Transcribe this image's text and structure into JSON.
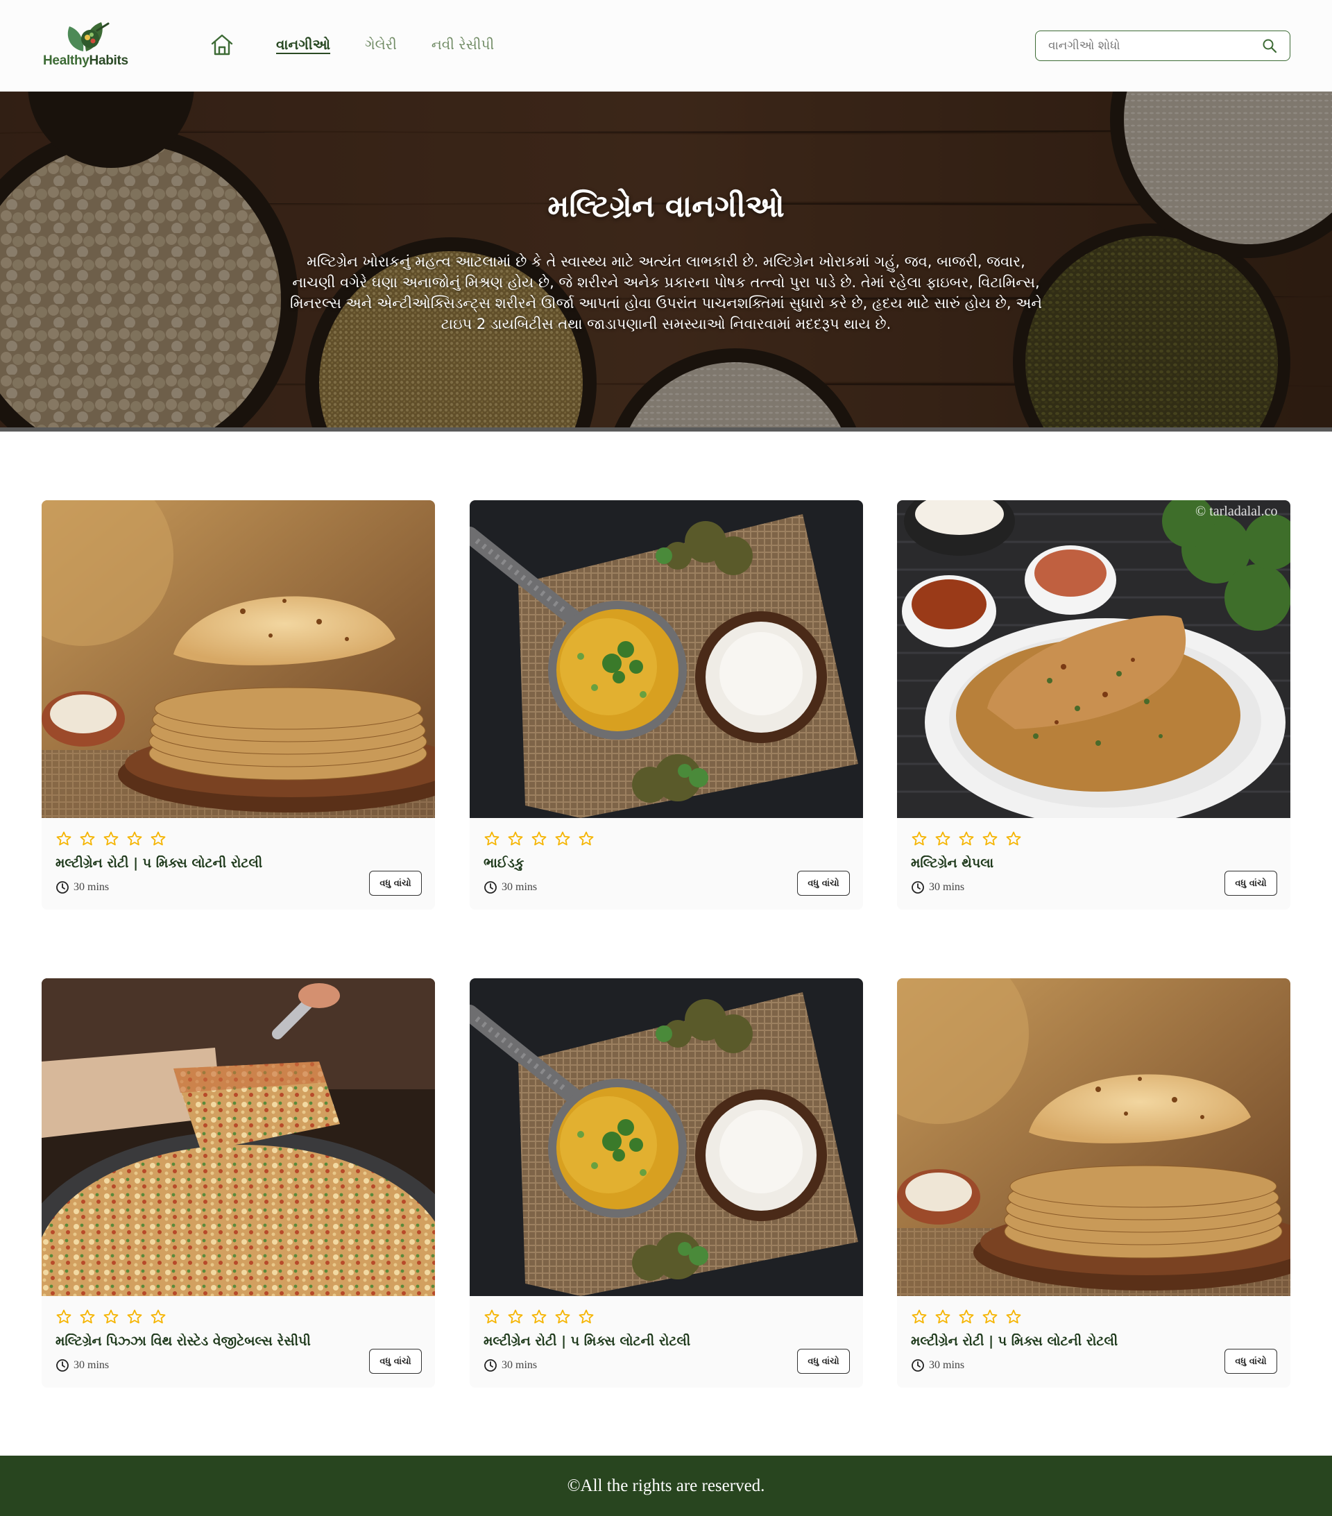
{
  "brand": {
    "name_part1": "Healthy",
    "name_part2": "Habits"
  },
  "nav": {
    "home_icon": "home-icon",
    "links": [
      {
        "label": "વાનગીઓ",
        "active": true
      },
      {
        "label": "ગેલેરી",
        "active": false
      },
      {
        "label": "નવી રેસીપી",
        "active": false
      }
    ]
  },
  "search": {
    "placeholder": "વાનગીઓ શોધો",
    "value": "",
    "icon": "search-icon"
  },
  "hero": {
    "title": "મલ્ટિગ્રેન વાનગીઓ",
    "text": "મલ્ટિગ્રેન ખોરાકનું મહત્વ આટલામાં છે કે તે સ્વાસ્થ્ય માટે અત્યંત લાભકારી છે. મલ્ટિગ્રેન ખોરાકમાં ગહું, જવ, બાજરી, જવાર, નાચણી વગેરે ઘણા અનાજોનું મિશ્રણ હોય છે, જે શરીરને અનેક પ્રકારના પોષક તત્ત્વો પુરા પાડે છે. તેમાં રહેલા ફાઇબર, વિટામિન્સ, મિનરલ્સ અને એન્ટીઓક્સિડન્ટ્સ શરીરને ઊર્જા આપતાં હોવા ઉપરાંત પાચનશક્તિમાં સુધારો કરે છે, હૃદય માટે સારું હોય છે, અને ટાઇપ 2 ડાયબિટીસ તથા જાડાપણાની સમસ્યાઓ નિવારવામાં મદદરૂપ થાય છે."
  },
  "recipes": [
    {
      "title": "મલ્ટીગ્રેન રોટી | ૫ મિક્સ લોટની રોટલી",
      "time": "30 mins",
      "rating": 0,
      "more_label": "વધુ વાંચો",
      "image": "roti"
    },
    {
      "title": "ભાઈડકુ",
      "time": "30 mins",
      "rating": 0,
      "more_label": "વધુ વાંચો",
      "image": "bhaidku"
    },
    {
      "title": "મલ્ટિગ્રેન થેપલા",
      "time": "30 mins",
      "rating": 0,
      "more_label": "વધુ વાંચો",
      "image": "thepla",
      "watermark": "© tarladalal.co"
    },
    {
      "title": "મલ્ટિગ્રેન પિઝ્ઝા વિથ રોસ્ટેડ વેજીટેબલ્સ રેસીપી",
      "time": "30 mins",
      "rating": 0,
      "more_label": "વધુ વાંચો",
      "image": "pizza"
    },
    {
      "title": "મલ્ટીગ્રેન રોટી | ૫ મિક્સ લોટની રોટલી",
      "time": "30 mins",
      "rating": 0,
      "more_label": "વધુ વાંચો",
      "image": "bhaidku"
    },
    {
      "title": "મલ્ટીગ્રેન રોટી | ૫ મિક્સ લોટની રોટલી",
      "time": "30 mins",
      "rating": 0,
      "more_label": "વધુ વાંચો",
      "image": "roti"
    }
  ],
  "footer": {
    "text": "©All the rights are reserved."
  },
  "colors": {
    "brand_green": "#3d6b35",
    "dark_green": "#28451f",
    "star": "#f5b400"
  }
}
